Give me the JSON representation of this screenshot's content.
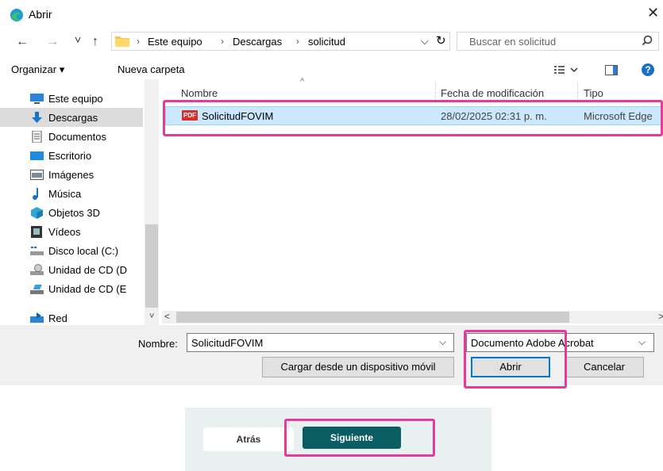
{
  "dialog": {
    "title": "Abrir",
    "close_glyph": "✕"
  },
  "address": {
    "back_glyph": "←",
    "forward_glyph": "→",
    "recent_glyph": "˅",
    "up_glyph": "↑",
    "crumbs": [
      "Este equipo",
      "Descargas",
      "solicitud"
    ],
    "separator": "›",
    "dropdown_glyph": "⌵",
    "refresh_glyph": "↻",
    "search_placeholder": "Buscar en solicitud"
  },
  "commandbar": {
    "organize_label": "Organizar ▾",
    "new_folder_label": "Nueva carpeta",
    "help_glyph": "?"
  },
  "navpane": {
    "items": [
      {
        "label": "Este equipo",
        "icon": "computer-icon"
      },
      {
        "label": "Descargas",
        "icon": "download-icon"
      },
      {
        "label": "Documentos",
        "icon": "documents-icon"
      },
      {
        "label": "Escritorio",
        "icon": "desktop-icon"
      },
      {
        "label": "Imágenes",
        "icon": "pictures-icon"
      },
      {
        "label": "Música",
        "icon": "music-icon"
      },
      {
        "label": "Objetos 3D",
        "icon": "objects3d-icon"
      },
      {
        "label": "Vídeos",
        "icon": "videos-icon"
      },
      {
        "label": "Disco local (C:)",
        "icon": "drive-icon"
      },
      {
        "label": "Unidad de CD (D",
        "icon": "cd-drive-icon"
      },
      {
        "label": "Unidad de CD (E",
        "icon": "cd-drive-icon"
      },
      {
        "label": "Red",
        "icon": "network-icon"
      }
    ],
    "selected_index": 1
  },
  "filelist": {
    "columns": [
      "Nombre",
      "Fecha de modificación",
      "Tipo"
    ],
    "rows": [
      {
        "name": "SolicitudFOVIM",
        "badge": "PDF",
        "date": "28/02/2025 02:31 p. m.",
        "type": "Microsoft Edge"
      }
    ]
  },
  "footer": {
    "name_label": "Nombre:",
    "name_value": "SolicitudFOVIM",
    "filter_value": "Documento Adobe Acrobat",
    "mobile_button": "Cargar desde un dispositivo móvil",
    "open_button": "Abrir",
    "cancel_button": "Cancelar"
  },
  "webform": {
    "back_button": "Atrás",
    "next_button": "Siguiente"
  },
  "colors": {
    "highlight": "#e6399b",
    "selection": "#cce8ff",
    "primary_button": "#0b5d64"
  }
}
